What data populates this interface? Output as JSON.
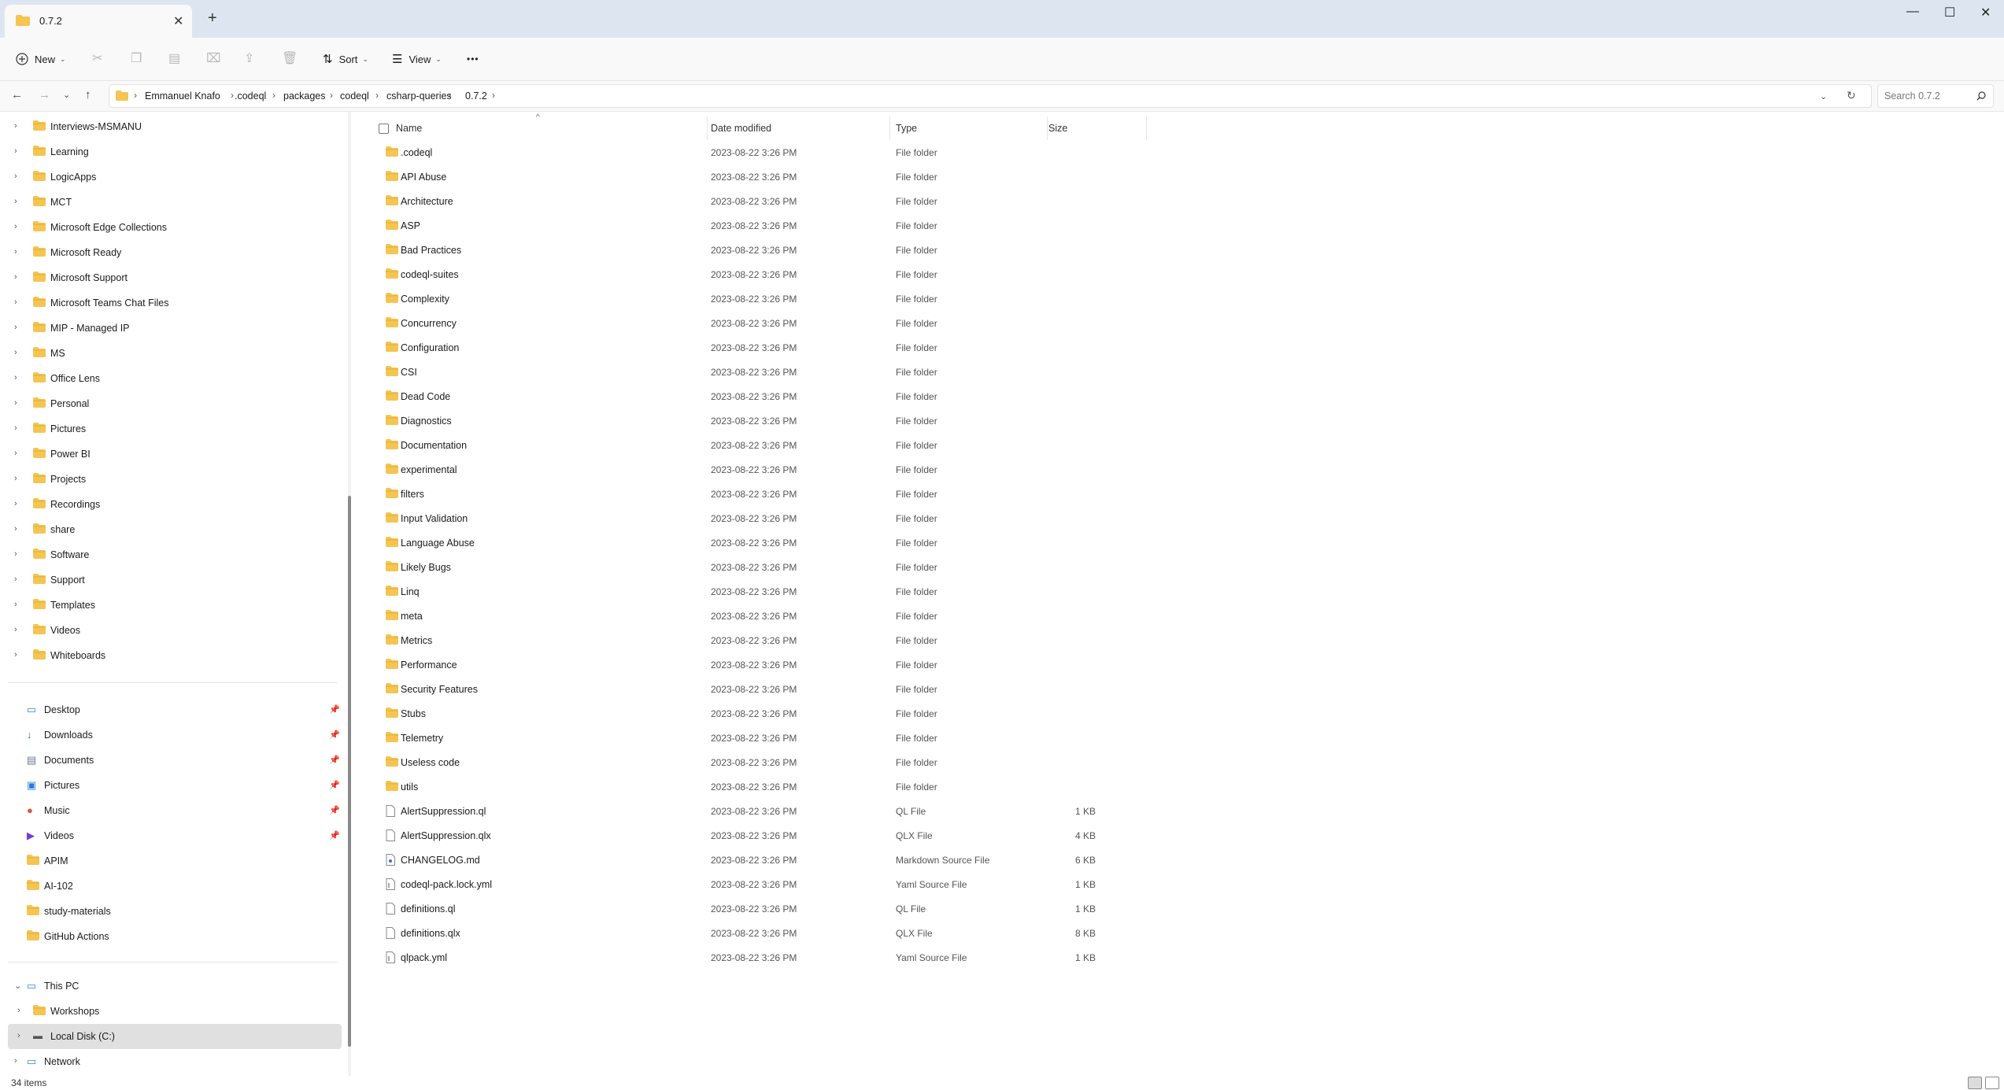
{
  "tab": {
    "title": "0.7.2",
    "close": "✕",
    "new": "+"
  },
  "window": {
    "minimize": "—",
    "maximize": "☐",
    "close": "✕"
  },
  "toolbar": {
    "new_label": "New",
    "sort_label": "Sort",
    "view_label": "View",
    "more_label": "•••"
  },
  "address": {
    "breadcrumbs": [
      "Emmanuel Knafo",
      ".codeql",
      "packages",
      "codeql",
      "csharp-queries",
      "0.7.2"
    ]
  },
  "search": {
    "placeholder": "Search 0.7.2"
  },
  "sidebar": {
    "tree_items": [
      "Interviews-MSMANU",
      "Learning",
      "LogicApps",
      "MCT",
      "Microsoft Edge Collections",
      "Microsoft Ready",
      "Microsoft Support",
      "Microsoft Teams Chat Files",
      "MIP - Managed IP",
      "MS",
      "Office Lens",
      "Personal",
      "Pictures",
      "Power BI",
      "Projects",
      "Recordings",
      "share",
      "Software",
      "Support",
      "Templates",
      "Videos",
      "Whiteboards"
    ],
    "quick_access": [
      {
        "label": "Desktop",
        "icon": "desktop-icon",
        "pinned": true
      },
      {
        "label": "Downloads",
        "icon": "download-icon",
        "pinned": true
      },
      {
        "label": "Documents",
        "icon": "documents-icon",
        "pinned": true
      },
      {
        "label": "Pictures",
        "icon": "pictures-icon",
        "pinned": true
      },
      {
        "label": "Music",
        "icon": "music-icon",
        "pinned": true
      },
      {
        "label": "Videos",
        "icon": "videos-icon",
        "pinned": true
      },
      {
        "label": "APIM",
        "icon": "folder-icon",
        "pinned": false
      },
      {
        "label": "AI-102",
        "icon": "folder-icon",
        "pinned": false
      },
      {
        "label": "study-materials",
        "icon": "folder-icon",
        "pinned": false
      },
      {
        "label": "GitHub Actions",
        "icon": "folder-icon",
        "pinned": false
      }
    ],
    "this_pc": "This PC",
    "pc_children": [
      "Workshops",
      "Local Disk (C:)"
    ],
    "network": "Network"
  },
  "columns": {
    "name": "Name",
    "date": "Date modified",
    "type": "Type",
    "size": "Size"
  },
  "files": [
    {
      "name": ".codeql",
      "date": "2023-08-22 3:26 PM",
      "type": "File folder",
      "size": "",
      "kind": "folder"
    },
    {
      "name": "API Abuse",
      "date": "2023-08-22 3:26 PM",
      "type": "File folder",
      "size": "",
      "kind": "folder"
    },
    {
      "name": "Architecture",
      "date": "2023-08-22 3:26 PM",
      "type": "File folder",
      "size": "",
      "kind": "folder"
    },
    {
      "name": "ASP",
      "date": "2023-08-22 3:26 PM",
      "type": "File folder",
      "size": "",
      "kind": "folder"
    },
    {
      "name": "Bad Practices",
      "date": "2023-08-22 3:26 PM",
      "type": "File folder",
      "size": "",
      "kind": "folder"
    },
    {
      "name": "codeql-suites",
      "date": "2023-08-22 3:26 PM",
      "type": "File folder",
      "size": "",
      "kind": "folder"
    },
    {
      "name": "Complexity",
      "date": "2023-08-22 3:26 PM",
      "type": "File folder",
      "size": "",
      "kind": "folder"
    },
    {
      "name": "Concurrency",
      "date": "2023-08-22 3:26 PM",
      "type": "File folder",
      "size": "",
      "kind": "folder"
    },
    {
      "name": "Configuration",
      "date": "2023-08-22 3:26 PM",
      "type": "File folder",
      "size": "",
      "kind": "folder"
    },
    {
      "name": "CSI",
      "date": "2023-08-22 3:26 PM",
      "type": "File folder",
      "size": "",
      "kind": "folder"
    },
    {
      "name": "Dead Code",
      "date": "2023-08-22 3:26 PM",
      "type": "File folder",
      "size": "",
      "kind": "folder"
    },
    {
      "name": "Diagnostics",
      "date": "2023-08-22 3:26 PM",
      "type": "File folder",
      "size": "",
      "kind": "folder"
    },
    {
      "name": "Documentation",
      "date": "2023-08-22 3:26 PM",
      "type": "File folder",
      "size": "",
      "kind": "folder"
    },
    {
      "name": "experimental",
      "date": "2023-08-22 3:26 PM",
      "type": "File folder",
      "size": "",
      "kind": "folder"
    },
    {
      "name": "filters",
      "date": "2023-08-22 3:26 PM",
      "type": "File folder",
      "size": "",
      "kind": "folder"
    },
    {
      "name": "Input Validation",
      "date": "2023-08-22 3:26 PM",
      "type": "File folder",
      "size": "",
      "kind": "folder"
    },
    {
      "name": "Language Abuse",
      "date": "2023-08-22 3:26 PM",
      "type": "File folder",
      "size": "",
      "kind": "folder"
    },
    {
      "name": "Likely Bugs",
      "date": "2023-08-22 3:26 PM",
      "type": "File folder",
      "size": "",
      "kind": "folder"
    },
    {
      "name": "Linq",
      "date": "2023-08-22 3:26 PM",
      "type": "File folder",
      "size": "",
      "kind": "folder"
    },
    {
      "name": "meta",
      "date": "2023-08-22 3:26 PM",
      "type": "File folder",
      "size": "",
      "kind": "folder"
    },
    {
      "name": "Metrics",
      "date": "2023-08-22 3:26 PM",
      "type": "File folder",
      "size": "",
      "kind": "folder"
    },
    {
      "name": "Performance",
      "date": "2023-08-22 3:26 PM",
      "type": "File folder",
      "size": "",
      "kind": "folder"
    },
    {
      "name": "Security Features",
      "date": "2023-08-22 3:26 PM",
      "type": "File folder",
      "size": "",
      "kind": "folder"
    },
    {
      "name": "Stubs",
      "date": "2023-08-22 3:26 PM",
      "type": "File folder",
      "size": "",
      "kind": "folder"
    },
    {
      "name": "Telemetry",
      "date": "2023-08-22 3:26 PM",
      "type": "File folder",
      "size": "",
      "kind": "folder"
    },
    {
      "name": "Useless code",
      "date": "2023-08-22 3:26 PM",
      "type": "File folder",
      "size": "",
      "kind": "folder"
    },
    {
      "name": "utils",
      "date": "2023-08-22 3:26 PM",
      "type": "File folder",
      "size": "",
      "kind": "folder"
    },
    {
      "name": "AlertSuppression.ql",
      "date": "2023-08-22 3:26 PM",
      "type": "QL File",
      "size": "1 KB",
      "kind": "file"
    },
    {
      "name": "AlertSuppression.qlx",
      "date": "2023-08-22 3:26 PM",
      "type": "QLX File",
      "size": "4 KB",
      "kind": "file"
    },
    {
      "name": "CHANGELOG.md",
      "date": "2023-08-22 3:26 PM",
      "type": "Markdown Source File",
      "size": "6 KB",
      "kind": "md"
    },
    {
      "name": "codeql-pack.lock.yml",
      "date": "2023-08-22 3:26 PM",
      "type": "Yaml Source File",
      "size": "1 KB",
      "kind": "yml"
    },
    {
      "name": "definitions.ql",
      "date": "2023-08-22 3:26 PM",
      "type": "QL File",
      "size": "1 KB",
      "kind": "file"
    },
    {
      "name": "definitions.qlx",
      "date": "2023-08-22 3:26 PM",
      "type": "QLX File",
      "size": "8 KB",
      "kind": "file"
    },
    {
      "name": "qlpack.yml",
      "date": "2023-08-22 3:26 PM",
      "type": "Yaml Source File",
      "size": "1 KB",
      "kind": "yml"
    }
  ],
  "status": {
    "item_count": "34 items"
  },
  "colors": {
    "folder": "#f4c552",
    "folder_dark": "#e1a82b",
    "accent": "#0067c0"
  }
}
